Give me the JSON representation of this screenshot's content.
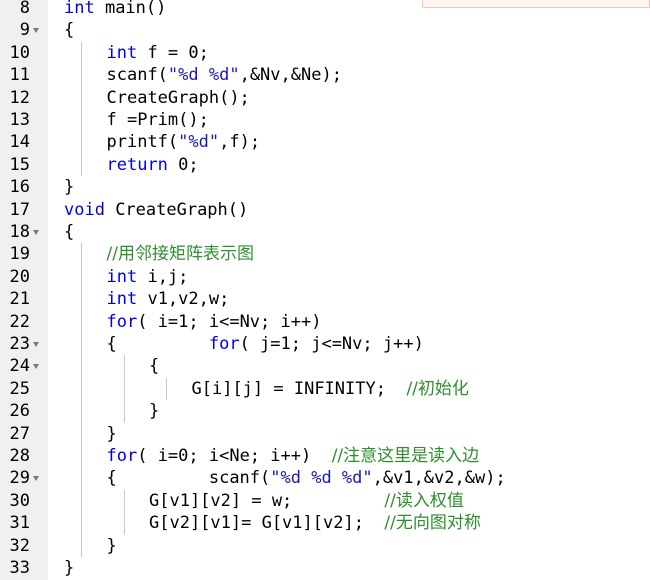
{
  "editor": {
    "lines": [
      {
        "num": "8",
        "fold": false,
        "indent": 0,
        "tokens": [
          {
            "t": "int",
            "c": "kw"
          },
          {
            "t": " main()",
            "c": ""
          }
        ]
      },
      {
        "num": "9",
        "fold": true,
        "indent": 0,
        "tokens": [
          {
            "t": "{",
            "c": ""
          }
        ]
      },
      {
        "num": "10",
        "fold": false,
        "indent": 1,
        "tokens": [
          {
            "t": "int",
            "c": "kw"
          },
          {
            "t": " f = ",
            "c": ""
          },
          {
            "t": "0",
            "c": "num"
          },
          {
            "t": ";",
            "c": ""
          }
        ]
      },
      {
        "num": "11",
        "fold": false,
        "indent": 1,
        "tokens": [
          {
            "t": "scanf(",
            "c": ""
          },
          {
            "t": "\"%d %d\"",
            "c": "str"
          },
          {
            "t": ",&Nv,&Ne);",
            "c": ""
          }
        ]
      },
      {
        "num": "12",
        "fold": false,
        "indent": 1,
        "tokens": [
          {
            "t": "CreateGraph();",
            "c": ""
          }
        ]
      },
      {
        "num": "13",
        "fold": false,
        "indent": 1,
        "tokens": [
          {
            "t": "f =Prim();",
            "c": ""
          }
        ]
      },
      {
        "num": "14",
        "fold": false,
        "indent": 1,
        "tokens": [
          {
            "t": "printf(",
            "c": ""
          },
          {
            "t": "\"%d\"",
            "c": "str"
          },
          {
            "t": ",f);",
            "c": ""
          }
        ]
      },
      {
        "num": "15",
        "fold": false,
        "indent": 1,
        "tokens": [
          {
            "t": "return",
            "c": "kw"
          },
          {
            "t": " ",
            "c": ""
          },
          {
            "t": "0",
            "c": "num"
          },
          {
            "t": ";",
            "c": ""
          }
        ]
      },
      {
        "num": "16",
        "fold": false,
        "indent": 0,
        "tokens": [
          {
            "t": "}",
            "c": ""
          }
        ]
      },
      {
        "num": "17",
        "fold": false,
        "indent": 0,
        "tokens": [
          {
            "t": "void",
            "c": "kw"
          },
          {
            "t": " CreateGraph()",
            "c": ""
          }
        ]
      },
      {
        "num": "18",
        "fold": true,
        "indent": 0,
        "tokens": [
          {
            "t": "{",
            "c": ""
          }
        ]
      },
      {
        "num": "19",
        "fold": false,
        "indent": 1,
        "tokens": [
          {
            "t": "//用邻接矩阵表示图",
            "c": "cm"
          }
        ]
      },
      {
        "num": "20",
        "fold": false,
        "indent": 1,
        "tokens": [
          {
            "t": "int",
            "c": "kw"
          },
          {
            "t": " i,j;",
            "c": ""
          }
        ]
      },
      {
        "num": "21",
        "fold": false,
        "indent": 1,
        "tokens": [
          {
            "t": "int",
            "c": "kw"
          },
          {
            "t": " v1,v2,w;",
            "c": ""
          }
        ]
      },
      {
        "num": "22",
        "fold": false,
        "indent": 1,
        "tokens": [
          {
            "t": "for",
            "c": "kw"
          },
          {
            "t": "( i=1; i<=Nv; i++)",
            "c": ""
          }
        ]
      },
      {
        "num": "23",
        "fold": true,
        "indent": 1,
        "tokens": [
          {
            "t": "{         ",
            "c": ""
          },
          {
            "t": "for",
            "c": "kw"
          },
          {
            "t": "( j=1; j<=Nv; j++)",
            "c": ""
          }
        ]
      },
      {
        "num": "24",
        "fold": true,
        "indent": 2,
        "tokens": [
          {
            "t": "{",
            "c": ""
          }
        ]
      },
      {
        "num": "25",
        "fold": false,
        "indent": 3,
        "tokens": [
          {
            "t": "G[i][j] = INFINITY;  ",
            "c": ""
          },
          {
            "t": "//初始化",
            "c": "cm"
          }
        ]
      },
      {
        "num": "26",
        "fold": false,
        "indent": 2,
        "tokens": [
          {
            "t": "}",
            "c": ""
          }
        ]
      },
      {
        "num": "27",
        "fold": false,
        "indent": 1,
        "tokens": [
          {
            "t": "}",
            "c": ""
          }
        ]
      },
      {
        "num": "28",
        "fold": false,
        "indent": 1,
        "tokens": [
          {
            "t": "for",
            "c": "kw"
          },
          {
            "t": "( i=0; i<Ne; i++)  ",
            "c": ""
          },
          {
            "t": "//注意这里是读入边",
            "c": "cm"
          }
        ]
      },
      {
        "num": "29",
        "fold": true,
        "indent": 1,
        "tokens": [
          {
            "t": "{         scanf(",
            "c": ""
          },
          {
            "t": "\"%d %d %d\"",
            "c": "str"
          },
          {
            "t": ",&v1,&v2,&w);",
            "c": ""
          }
        ]
      },
      {
        "num": "30",
        "fold": false,
        "indent": 2,
        "tokens": [
          {
            "t": "G[v1][v2] = w;         ",
            "c": ""
          },
          {
            "t": "//读入权值",
            "c": "cm"
          }
        ]
      },
      {
        "num": "31",
        "fold": false,
        "indent": 2,
        "tokens": [
          {
            "t": "G[v2][v1]= G[v1][v2];  ",
            "c": ""
          },
          {
            "t": "//无向图对称",
            "c": "cm"
          }
        ]
      },
      {
        "num": "32",
        "fold": false,
        "indent": 1,
        "tokens": [
          {
            "t": "}",
            "c": ""
          }
        ]
      },
      {
        "num": "33",
        "fold": false,
        "indent": 0,
        "tokens": [
          {
            "t": "}",
            "c": ""
          }
        ]
      }
    ]
  },
  "colors": {
    "keyword": "#0000e6",
    "string": "#1a1ab8",
    "comment": "#2f8f2f",
    "gutter": "#f0f0f0"
  }
}
